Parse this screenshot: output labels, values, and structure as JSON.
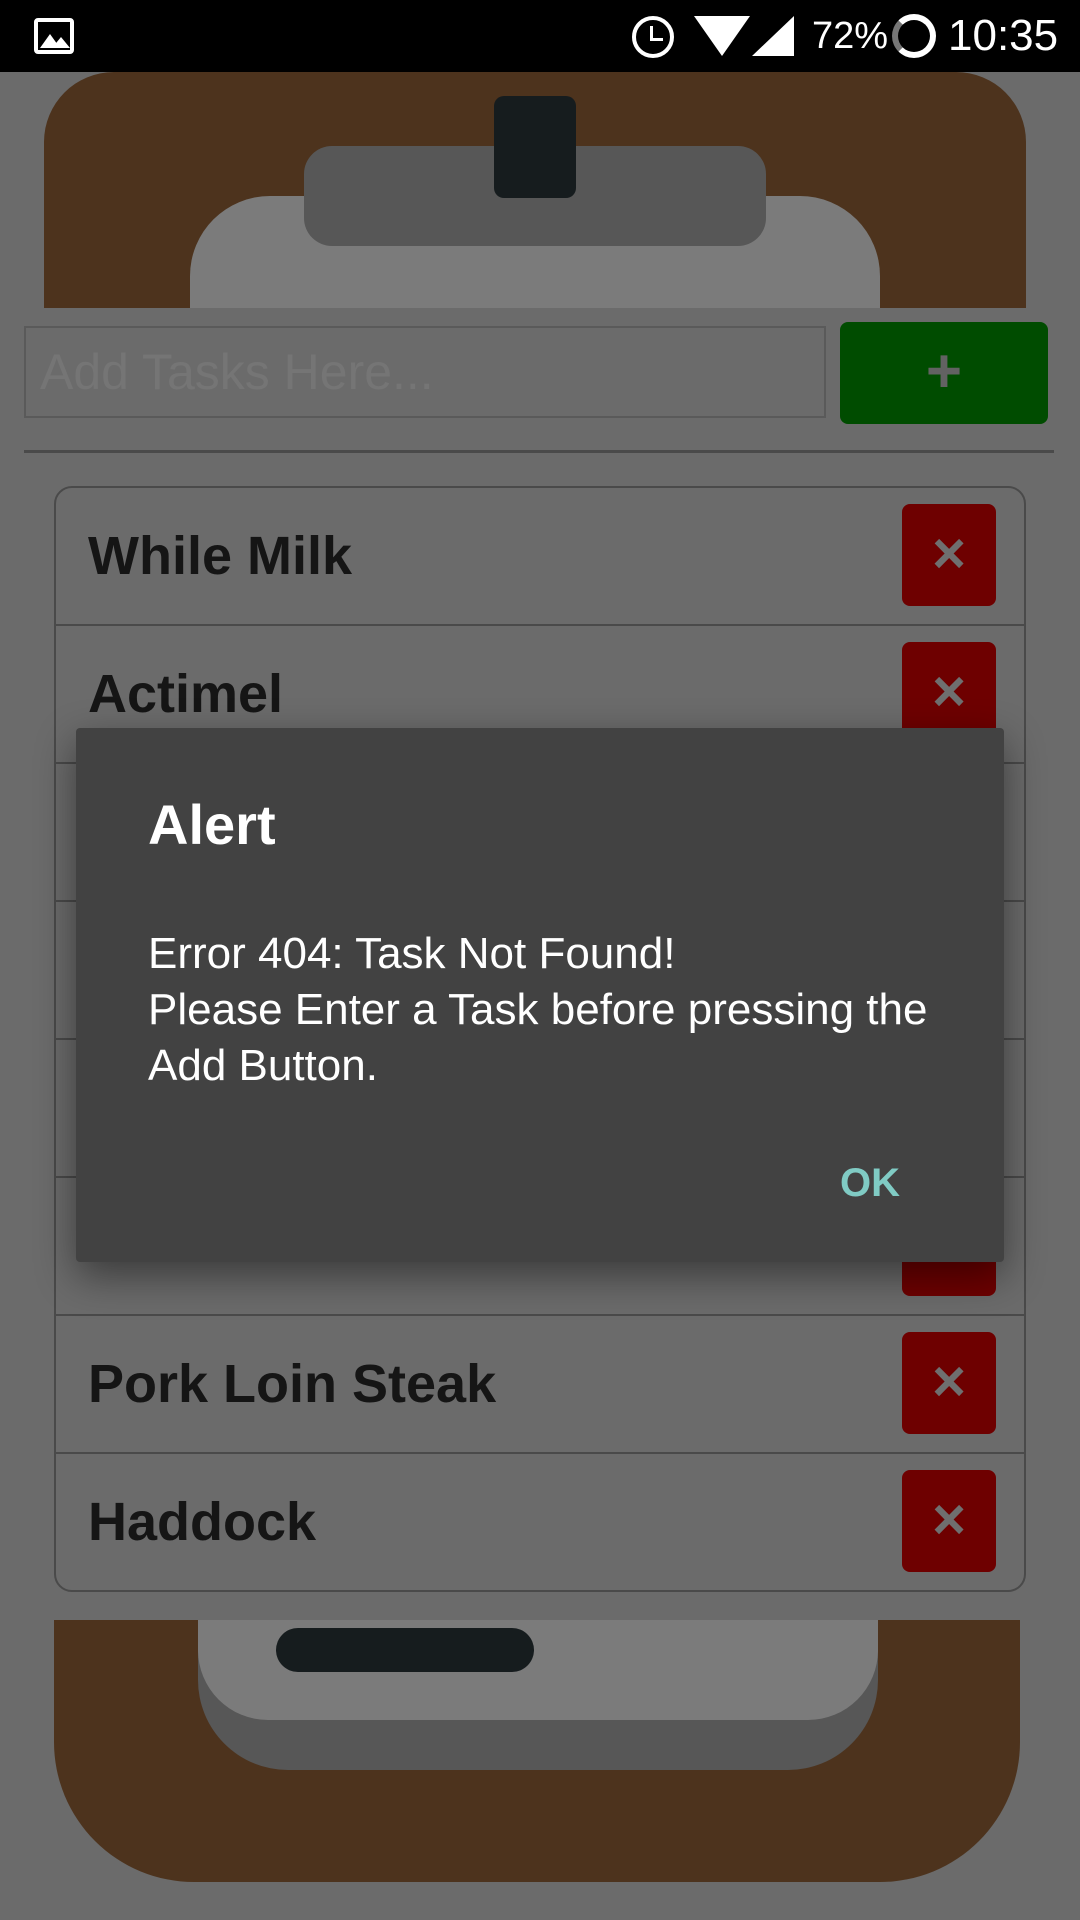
{
  "status_bar": {
    "icons": [
      "image-icon",
      "alarm-icon",
      "wifi-icon",
      "signal-icon",
      "sync-ring-icon"
    ],
    "battery": "72%",
    "time": "10:35"
  },
  "input": {
    "placeholder": "Add Tasks Here..."
  },
  "add_button": {
    "label": "+"
  },
  "tasks": [
    {
      "label": "While Milk",
      "delete_label": "×"
    },
    {
      "label": "Actimel",
      "delete_label": "×"
    },
    {
      "label": "",
      "delete_label": "×"
    },
    {
      "label": "",
      "delete_label": "×"
    },
    {
      "label": "",
      "delete_label": "×"
    },
    {
      "label": "",
      "delete_label": "×"
    },
    {
      "label": "Pork Loin Steak",
      "delete_label": "×"
    },
    {
      "label": "Haddock",
      "delete_label": "×"
    }
  ],
  "dialog": {
    "title": "Alert",
    "message": "Error 404: Task Not Found!\nPlease Enter a Task before pressing the Add Button.",
    "ok_label": "OK"
  },
  "colors": {
    "board": "#4d331d",
    "add_button": "#004c00",
    "delete_button": "#6e0000",
    "dialog_bg": "#424242",
    "dialog_accent": "#80cbc4"
  }
}
